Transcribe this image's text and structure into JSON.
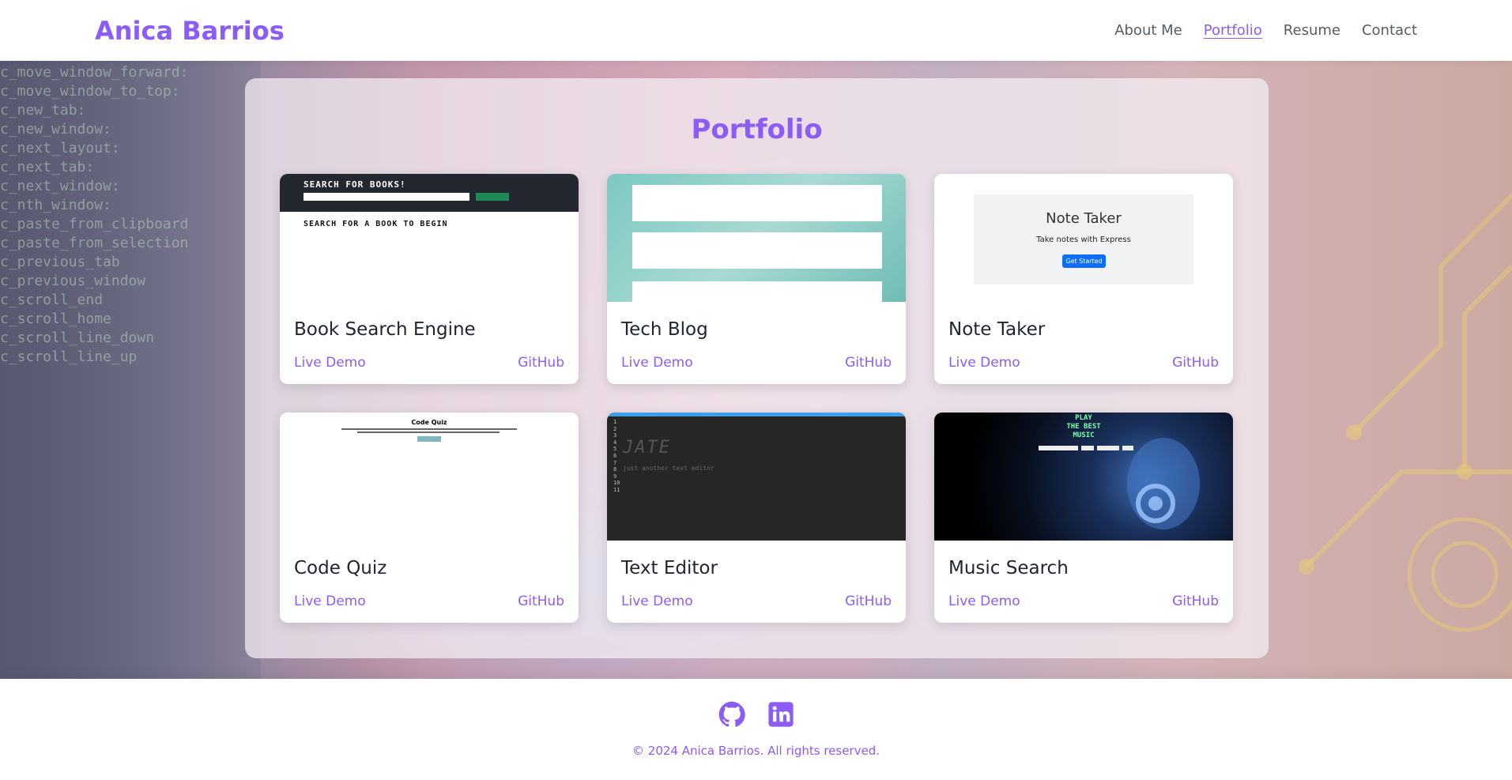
{
  "header": {
    "brand": "Anica Barrios",
    "nav": [
      {
        "label": "About Me",
        "active": false
      },
      {
        "label": "Portfolio",
        "active": true
      },
      {
        "label": "Resume",
        "active": false
      },
      {
        "label": "Contact",
        "active": false
      }
    ]
  },
  "portfolio": {
    "title": "Portfolio",
    "projects": [
      {
        "title": "Book Search Engine",
        "demo_label": "Live Demo",
        "github_label": "GitHub"
      },
      {
        "title": "Tech Blog",
        "demo_label": "Live Demo",
        "github_label": "GitHub"
      },
      {
        "title": "Note Taker",
        "demo_label": "Live Demo",
        "github_label": "GitHub"
      },
      {
        "title": "Code Quiz",
        "demo_label": "Live Demo",
        "github_label": "GitHub"
      },
      {
        "title": "Text Editor",
        "demo_label": "Live Demo",
        "github_label": "GitHub"
      },
      {
        "title": "Music Search",
        "demo_label": "Live Demo",
        "github_label": "GitHub"
      }
    ],
    "thumbnails": {
      "book": {
        "heading": "SEARCH FOR BOOKS!",
        "subheading": "SEARCH FOR A BOOK TO BEGIN"
      },
      "note": {
        "heading": "Note Taker",
        "subheading": "Take notes with Express",
        "button": "Get Started"
      },
      "quiz": {
        "heading": "Code Quiz"
      },
      "editor": {
        "line_numbers": "1\n2\n3\n4\n5\n6\n7\n8\n9\n10\n11",
        "art": "JATE",
        "caption": "just another text editor"
      },
      "music": {
        "heading": "PLAY\nTHE BEST\nMUSIC"
      }
    }
  },
  "footer": {
    "icons": [
      "github-icon",
      "linkedin-icon"
    ],
    "copyright": "© 2024 Anica Barrios. All rights reserved."
  },
  "colors": {
    "accent": "#8b5cf6",
    "text_dark": "#1f2430",
    "nav_text": "#555c66"
  }
}
